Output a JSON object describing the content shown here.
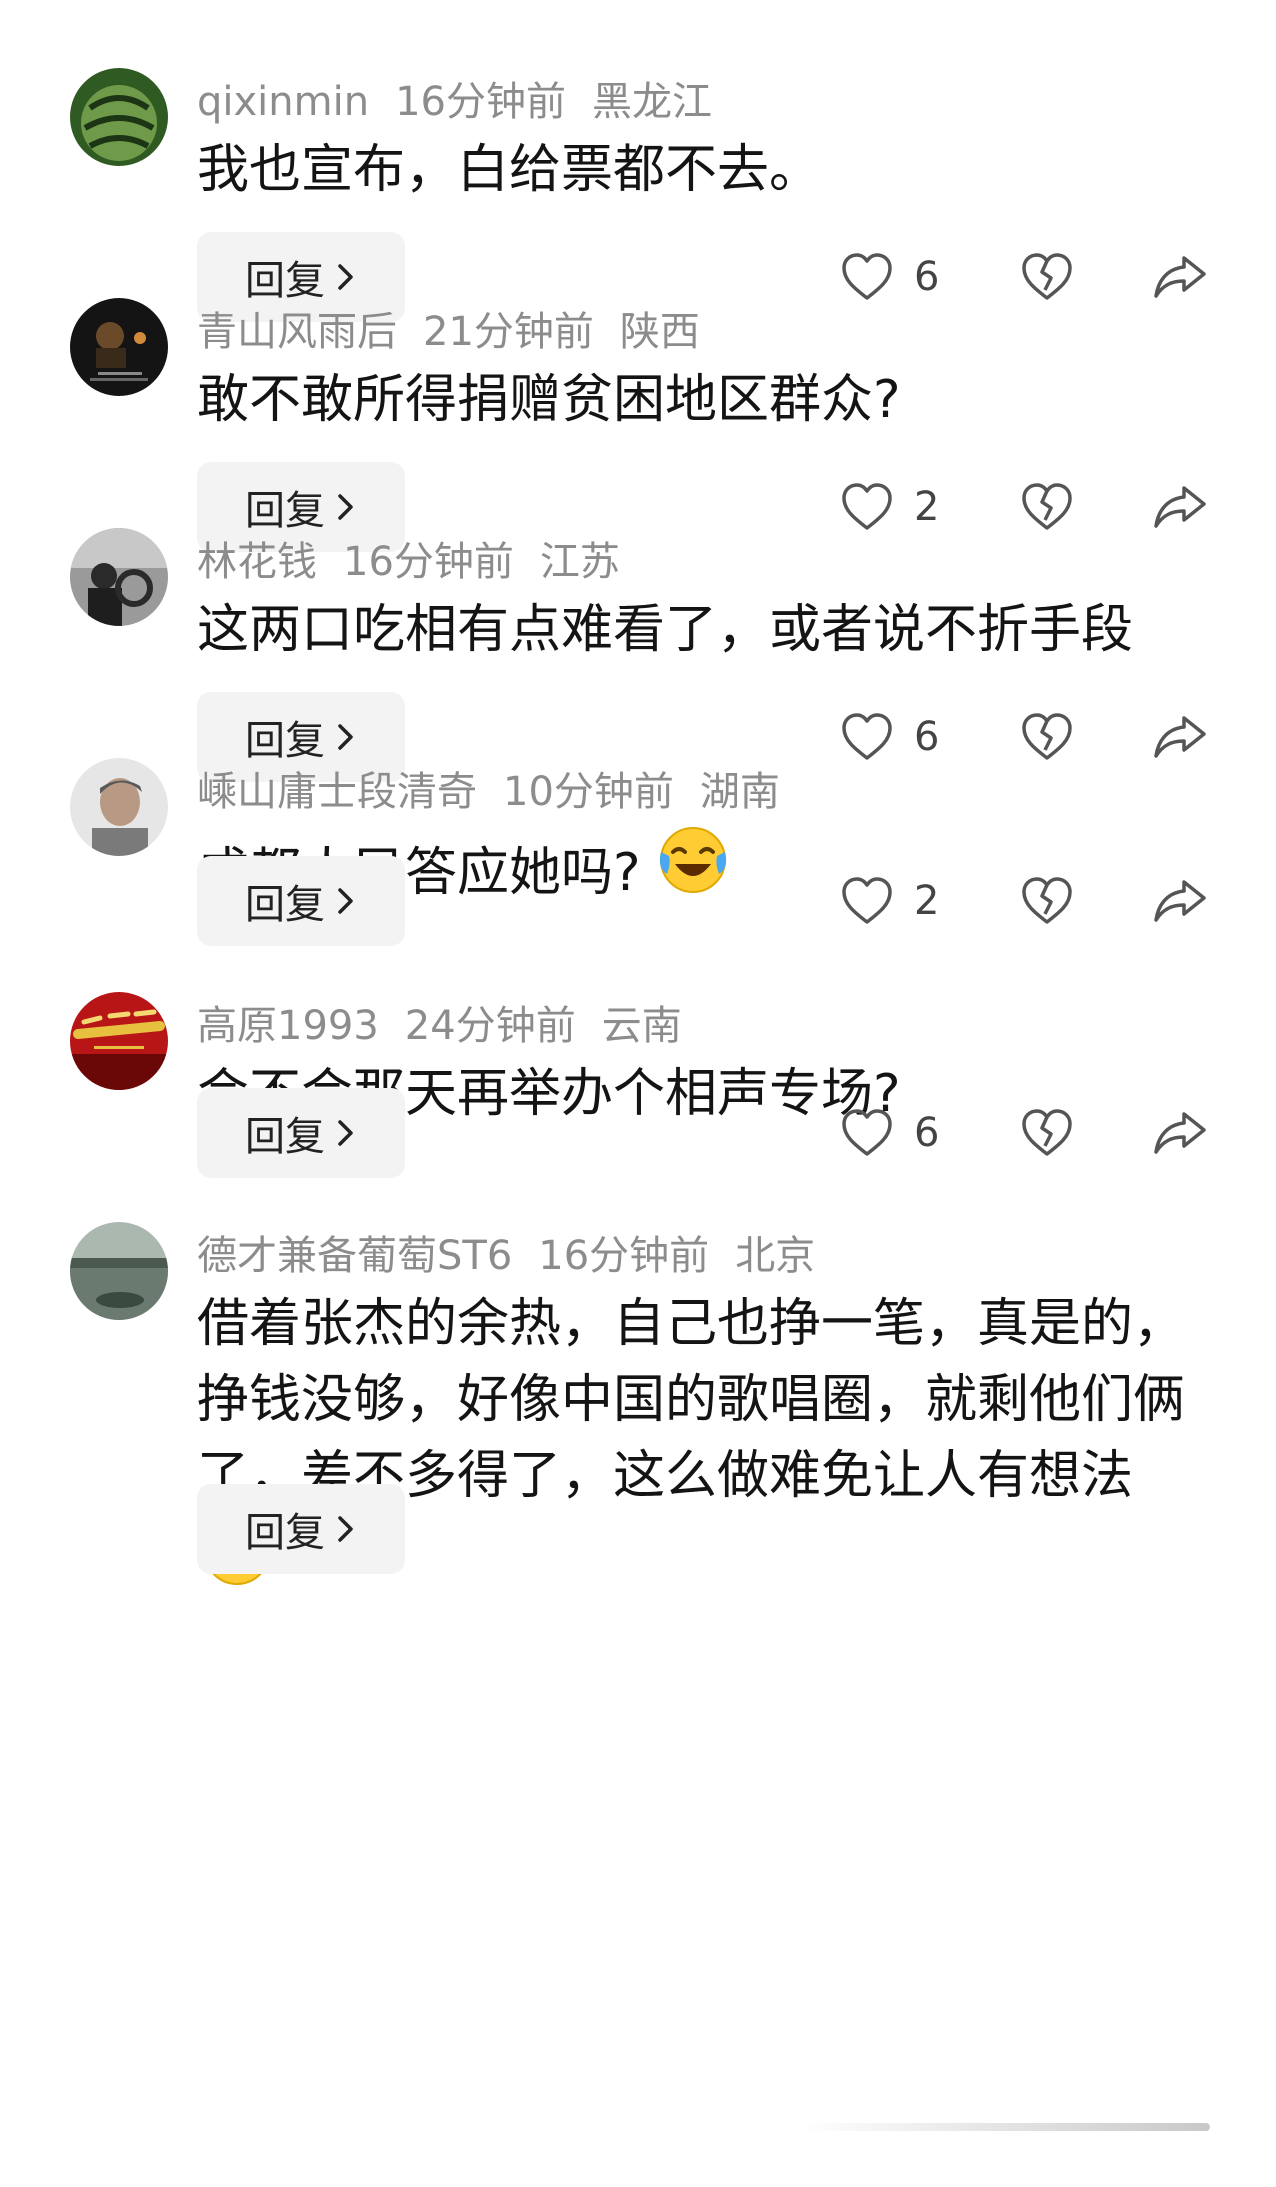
{
  "comments": [
    {
      "username": "qixinmin",
      "time": "16分钟前",
      "location": "黑龙江",
      "text": "我也宣布，白给票都不去。",
      "reply_label": "回复",
      "likes": "6",
      "avatar_colors": [
        "#2f5a22",
        "#6e9a4a",
        "#1c3514"
      ]
    },
    {
      "username": "青山风雨后",
      "time": "21分钟前",
      "location": "陕西",
      "text": "敢不敢所得捐赠贫困地区群众?",
      "reply_label": "回复",
      "likes": "2",
      "avatar_colors": [
        "#1a1a1a",
        "#6b4a2a",
        "#d08a3a"
      ]
    },
    {
      "username": "林花钱",
      "time": "16分钟前",
      "location": "江苏",
      "text": "这两口吃相有点难看了，或者说不折手段",
      "reply_label": "回复",
      "likes": "6",
      "avatar_colors": [
        "#3c3c3c",
        "#a8a8a8",
        "#1e1e1e"
      ]
    },
    {
      "username": "嵊山庸士段清奇",
      "time": "10分钟前",
      "location": "湖南",
      "text": "成都人民答应她吗?",
      "emoji": "laugh-cry-emoji",
      "reply_label": "回复",
      "likes": "2",
      "avatar_colors": [
        "#d8d8d8",
        "#7a7a7a",
        "#f0f0f0"
      ]
    },
    {
      "username": "高原1993",
      "time": "24分钟前",
      "location": "云南",
      "text": "会不会那天再举办个相声专场?",
      "reply_label": "回复",
      "likes": "6",
      "avatar_colors": [
        "#b81616",
        "#e8c040",
        "#6a0808"
      ]
    },
    {
      "username": "德才兼备葡萄ST6",
      "time": "16分钟前",
      "location": "北京",
      "text": "借着张杰的余热，自己也挣一笔，真是的，挣钱没够，好像中国的歌唱圈，就剩他们俩了，差不多得了，这么做难免让人有想法",
      "emoji": "star-eyes-emoji",
      "reply_label": "回复",
      "likes": "",
      "avatar_colors": [
        "#6a7a70",
        "#9aaaa0",
        "#3a4a40"
      ]
    }
  ]
}
